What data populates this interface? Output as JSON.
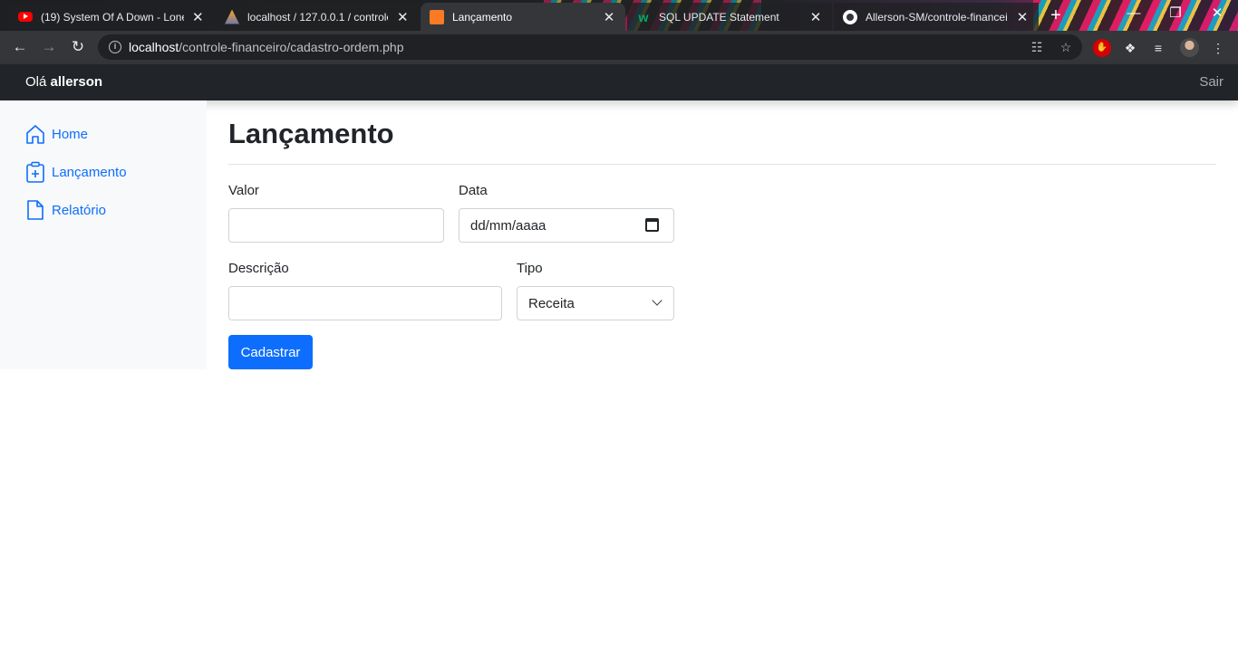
{
  "browser": {
    "tabs": [
      {
        "title": "(19) System Of A Down - Lonel",
        "favicon": "youtube-icon",
        "active": false
      },
      {
        "title": "localhost / 127.0.0.1 / controle",
        "favicon": "phpmyadmin-icon",
        "active": false
      },
      {
        "title": "Lançamento",
        "favicon": "xampp-icon",
        "active": true
      },
      {
        "title": "SQL UPDATE Statement",
        "favicon": "w3schools-icon",
        "active": false
      },
      {
        "title": "Allerson-SM/controle-financei",
        "favicon": "github-icon",
        "active": false
      }
    ],
    "close_glyph": "✕",
    "new_tab_glyph": "+",
    "url_host": "localhost",
    "url_path": "/controle-financeiro/cadastro-ordem.php"
  },
  "navbar": {
    "greeting_prefix": "Olá",
    "user_name": "allerson",
    "logout_label": "Sair",
    "background": "#212529"
  },
  "sidebar": {
    "items": [
      {
        "label": "Home",
        "icon": "house-icon"
      },
      {
        "label": "Lançamento",
        "icon": "clipboard-plus-icon"
      },
      {
        "label": "Relatório",
        "icon": "file-icon"
      }
    ],
    "link_color": "#0d6efd"
  },
  "main": {
    "title": "Lançamento",
    "form": {
      "valor_label": "Valor",
      "valor_value": "",
      "data_label": "Data",
      "data_placeholder": "dd/mm/aaaa",
      "descricao_label": "Descrição",
      "descricao_value": "",
      "tipo_label": "Tipo",
      "tipo_selected": "Receita",
      "submit_label": "Cadastrar"
    },
    "accent": "#0d6efd"
  }
}
